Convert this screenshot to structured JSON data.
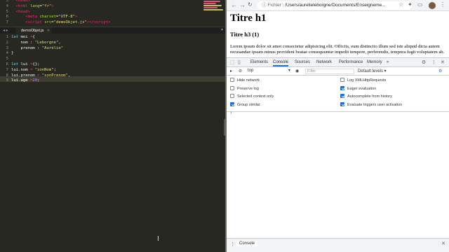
{
  "editor": {
    "top_lines": [
      {
        "n": "3",
        "html_parts": [
          [
            "tag",
            "  <"
          ],
          [
            "tag",
            "head"
          ],
          [
            "tag",
            ">"
          ]
        ]
      },
      {
        "n": "4",
        "html_parts": [
          [
            "tag",
            "  <"
          ],
          [
            "tag",
            "html"
          ],
          [
            "plain",
            " "
          ],
          [
            "attr",
            "lang"
          ],
          [
            "plain",
            "="
          ],
          [
            "str",
            "\"fr\""
          ],
          [
            "tag",
            ">"
          ]
        ]
      },
      {
        "n": "5",
        "html_parts": [
          [
            "tag",
            "  <"
          ],
          [
            "tag",
            "head"
          ],
          [
            "tag",
            ">"
          ]
        ]
      },
      {
        "n": "6",
        "html_parts": [
          [
            "plain",
            "      "
          ],
          [
            "tag",
            "<"
          ],
          [
            "tag",
            "meta"
          ],
          [
            "plain",
            " "
          ],
          [
            "attr",
            "charset"
          ],
          [
            "plain",
            "="
          ],
          [
            "str",
            "\"UTF-8\""
          ],
          [
            "tag",
            ">"
          ]
        ]
      },
      {
        "n": "7",
        "html_parts": [
          [
            "plain",
            "      "
          ],
          [
            "tag",
            "<"
          ],
          [
            "tag",
            "script"
          ],
          [
            "plain",
            " "
          ],
          [
            "attr",
            "src"
          ],
          [
            "plain",
            "="
          ],
          [
            "str",
            "\"demoObjet.js\""
          ],
          [
            "tag",
            "></"
          ],
          [
            "tag",
            "script"
          ],
          [
            "tag",
            ">"
          ]
        ]
      }
    ],
    "tab_name": "demoObjet.js",
    "lines": [
      {
        "n": "1",
        "parts": [
          [
            "kw",
            "let"
          ],
          [
            "plain",
            " moi "
          ],
          [
            "op",
            "="
          ],
          [
            "plain",
            "{"
          ]
        ]
      },
      {
        "n": "2",
        "parts": [
          [
            "plain",
            "    nom : "
          ],
          [
            "str",
            "\"Leborgne\""
          ],
          [
            "plain",
            ","
          ]
        ]
      },
      {
        "n": "3",
        "parts": [
          [
            "plain",
            "    prenom : "
          ],
          [
            "str",
            "\"Aurélie\""
          ]
        ]
      },
      {
        "n": "4",
        "parts": [
          [
            "plain",
            "}"
          ]
        ]
      },
      {
        "n": "5",
        "parts": []
      },
      {
        "n": "6",
        "parts": [
          [
            "kw",
            "let"
          ],
          [
            "plain",
            " lui "
          ],
          [
            "op",
            "="
          ],
          [
            "plain",
            "{};"
          ]
        ]
      },
      {
        "n": "7",
        "parts": [
          [
            "plain",
            "lui.nom "
          ],
          [
            "op",
            "="
          ],
          [
            "plain",
            " "
          ],
          [
            "str",
            "\"sonNom\""
          ],
          [
            "plain",
            ";"
          ]
        ]
      },
      {
        "n": "8",
        "parts": [
          [
            "plain",
            "lui.prenom "
          ],
          [
            "op",
            "="
          ],
          [
            "plain",
            " "
          ],
          [
            "str",
            "\"sonPrenom\""
          ],
          [
            "plain",
            ","
          ]
        ]
      },
      {
        "n": "9",
        "parts": [
          [
            "plain",
            "lui.age "
          ],
          [
            "op",
            "="
          ],
          [
            "num",
            "20"
          ],
          [
            "plain",
            ";"
          ]
        ]
      }
    ]
  },
  "browser": {
    "url_protocol": "Fichier",
    "url_path": "/Users/aurelieleborgne/Documents/Enseigneme...",
    "page": {
      "h1": "Titre h1",
      "h3": "Titre h3 (1)",
      "paragraph": "Lorem ipsum dolor sit amet consectetur adipisicing elit. Officiis, eum distinctio illum sed iste aliquid dicta autem recusandae ipsum minus provident beatae consequuntur impedit tempore, perferendis, tempora fugit voluptatem ab."
    }
  },
  "devtools": {
    "tabs": [
      "Elements",
      "Console",
      "Sources",
      "Network",
      "Performance",
      "Memory"
    ],
    "active_tab": "Console",
    "more_tabs": "»",
    "context": "top",
    "filter_placeholder": "Filter",
    "levels": "Default levels ▾",
    "settings": [
      {
        "label": "Hide network",
        "checked": false,
        "col": 0,
        "row": 0
      },
      {
        "label": "Log XMLHttpRequests",
        "checked": false,
        "col": 1,
        "row": 0
      },
      {
        "label": "Preserve log",
        "checked": false,
        "col": 0,
        "row": 1
      },
      {
        "label": "Eager evaluation",
        "checked": true,
        "col": 1,
        "row": 1
      },
      {
        "label": "Selected context only",
        "checked": false,
        "col": 0,
        "row": 2
      },
      {
        "label": "Autocomplete from history",
        "checked": true,
        "col": 1,
        "row": 2
      },
      {
        "label": "Group similar",
        "checked": true,
        "col": 0,
        "row": 3
      },
      {
        "label": "Evaluate triggers user activation",
        "checked": true,
        "col": 1,
        "row": 3
      }
    ],
    "prompt": "›",
    "drawer_tab": "Console",
    "accent": "#1a73e8"
  }
}
